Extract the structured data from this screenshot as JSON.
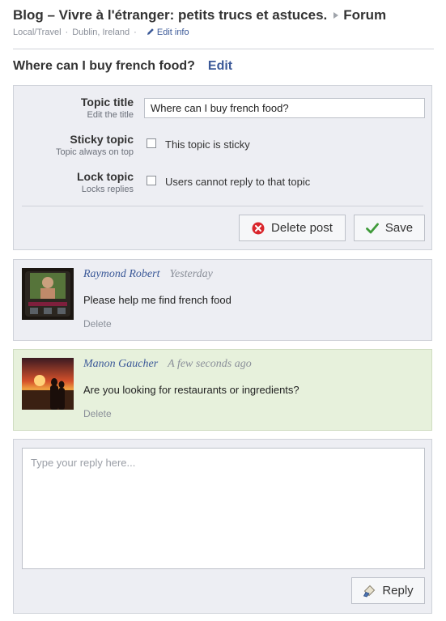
{
  "header": {
    "title": "Blog – Vivre à l'étranger: petits trucs et astuces.",
    "section": "Forum",
    "category": "Local/Travel",
    "location": "Dublin, Ireland",
    "edit_info": "Edit info"
  },
  "topic": {
    "heading": "Where can I buy french food?",
    "edit_label": "Edit"
  },
  "edit_form": {
    "title_label": "Topic title",
    "title_sub": "Edit the title",
    "title_value": "Where can I buy french food?",
    "sticky_label": "Sticky topic",
    "sticky_sub": "Topic always on top",
    "sticky_text": "This topic is sticky",
    "sticky_checked": false,
    "lock_label": "Lock topic",
    "lock_sub": "Locks replies",
    "lock_text": "Users cannot reply to that topic",
    "lock_checked": false,
    "delete_label": "Delete post",
    "save_label": "Save"
  },
  "posts": [
    {
      "author": "Raymond Robert",
      "time": "Yesterday",
      "message": "Please help me find french food",
      "delete_label": "Delete"
    },
    {
      "author": "Manon Gaucher",
      "time": "A few seconds ago",
      "message": "Are you looking for restaurants or ingredients?",
      "delete_label": "Delete"
    }
  ],
  "reply": {
    "placeholder": "Type your reply here...",
    "button_label": "Reply"
  },
  "colors": {
    "link": "#3b5998",
    "panel": "#edeef3",
    "new_post": "#e7f1dc",
    "delete_icon": "#d9262c",
    "save_icon": "#3f9a3a"
  },
  "icons": [
    "pencil-icon",
    "delete-icon",
    "check-icon",
    "reply-icon"
  ]
}
